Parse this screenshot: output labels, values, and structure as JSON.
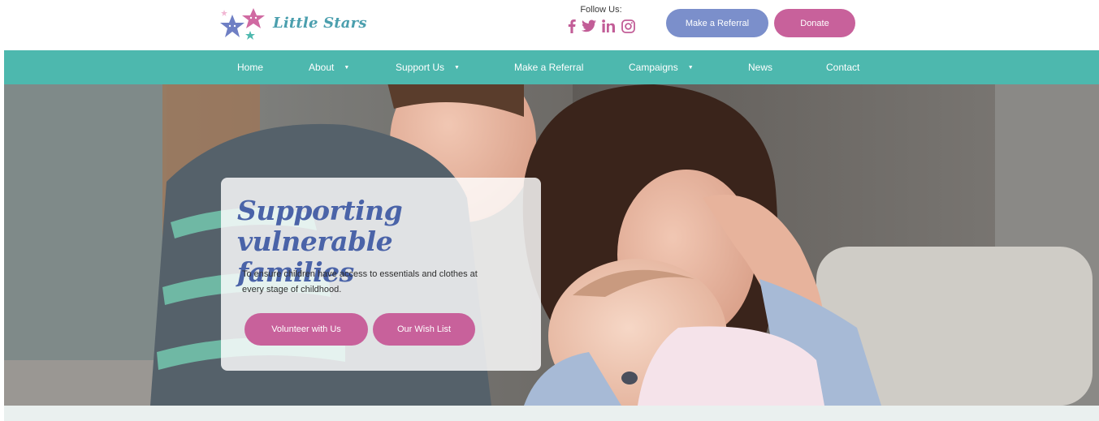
{
  "header": {
    "logo_text": "Little Stars",
    "follow_label": "Follow Us:",
    "social": [
      {
        "name": "facebook-icon",
        "glyph": "f"
      },
      {
        "name": "twitter-icon",
        "glyph": "twitter"
      },
      {
        "name": "linkedin-icon",
        "glyph": "in"
      },
      {
        "name": "instagram-icon",
        "glyph": "instagram"
      }
    ],
    "referral_label": "Make a Referral",
    "donate_label": "Donate"
  },
  "nav": {
    "items": [
      {
        "label": "Home",
        "dropdown": false
      },
      {
        "label": "About",
        "dropdown": true
      },
      {
        "label": "Support Us",
        "dropdown": true
      },
      {
        "label": "Make a Referral",
        "dropdown": false
      },
      {
        "label": "Campaigns",
        "dropdown": true
      },
      {
        "label": "News",
        "dropdown": false
      },
      {
        "label": "Contact",
        "dropdown": false
      }
    ],
    "caret": "▼"
  },
  "hero": {
    "title_line1": "Supporting vulnerable",
    "title_line2": "families",
    "subtitle_line1": "To ensure children have access to essentials and clothes at",
    "subtitle_line2": "every stage of childhood.",
    "volunteer_label": "Volunteer with Us",
    "wishlist_label": "Our Wish List"
  },
  "colors": {
    "teal": "#4db8ae",
    "pink": "#c8619b",
    "periwinkle": "#7b8fcb",
    "title_blue": "#4a63a8"
  }
}
